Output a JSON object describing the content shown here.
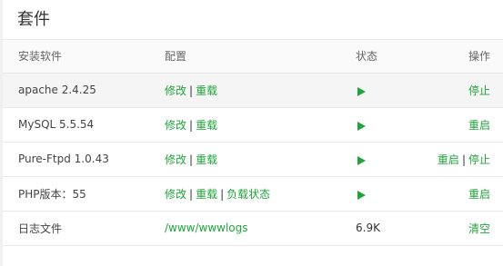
{
  "panel": {
    "title": "套件"
  },
  "headers": {
    "software": "安装软件",
    "config": "配置",
    "status": "状态",
    "action": "操作"
  },
  "rows": [
    {
      "name": "apache 2.4.25",
      "config": [
        "修改",
        "重载"
      ],
      "actions": [
        "停止"
      ]
    },
    {
      "name": "MySQL 5.5.54",
      "config": [
        "修改",
        "重载"
      ],
      "actions": [
        "重启"
      ]
    },
    {
      "name": "Pure-Ftpd 1.0.43",
      "config": [
        "修改",
        "重载"
      ],
      "actions": [
        "重启",
        "停止"
      ]
    },
    {
      "name": "PHP版本：55",
      "config": [
        "修改",
        "重载",
        "负载状态"
      ],
      "actions": [
        "重启"
      ]
    },
    {
      "name": "日志文件",
      "config": [
        "/www/wwwlogs"
      ],
      "status_text": "6.9K",
      "actions": [
        "清空"
      ]
    }
  ],
  "separator": "|",
  "colors": {
    "accent": "#20a53a"
  },
  "icons": {
    "running": "play-icon"
  }
}
